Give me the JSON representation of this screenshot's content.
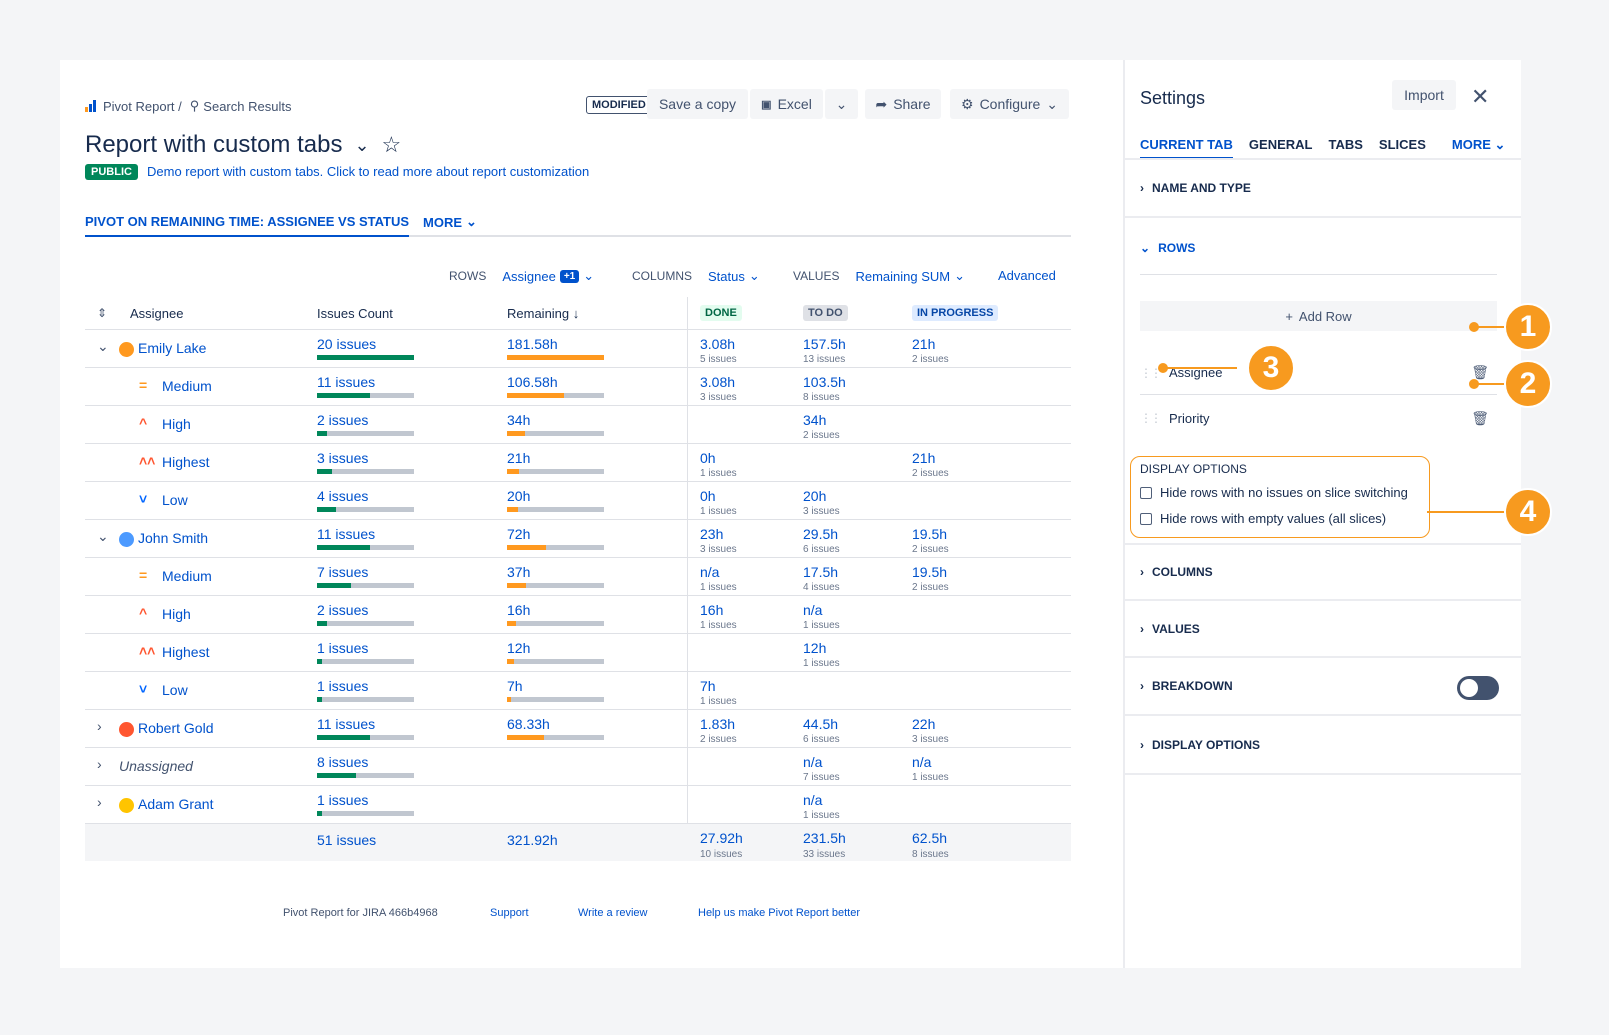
{
  "breadcrumb": {
    "app": "Pivot Report /",
    "search": "Search Results"
  },
  "toolbar": {
    "modified": "MODIFIED",
    "save_copy": "Save a copy",
    "excel": "Excel",
    "share": "Share",
    "configure": "Configure"
  },
  "report": {
    "title": "Report with custom tabs",
    "visibility": "PUBLIC",
    "description": "Demo report with custom tabs. Click to read more about report customization"
  },
  "tabs": {
    "active": "PIVOT ON REMAINING TIME: ASSIGNEE VS STATUS",
    "more": "MORE"
  },
  "config": {
    "rows_label": "ROWS",
    "rows_value": "Assignee",
    "rows_extra": "+1",
    "columns_label": "COLUMNS",
    "columns_value": "Status",
    "values_label": "VALUES",
    "values_value": "Remaining SUM",
    "advanced": "Advanced"
  },
  "table": {
    "headers": {
      "assignee": "Assignee",
      "count": "Issues Count",
      "remaining": "Remaining",
      "done": "DONE",
      "todo": "TO DO",
      "inprogress": "IN PROGRESS"
    },
    "rows": [
      {
        "name": "Emily Lake",
        "level": 0,
        "expanded": true,
        "avatar": "#ff991f",
        "count": "20 issues",
        "count_frac": 1.0,
        "rem": "181.58h",
        "rem_frac": 1.0,
        "done": "3.08h",
        "done_sub": "5 issues",
        "todo": "157.5h",
        "todo_sub": "13 issues",
        "prog": "21h",
        "prog_sub": "2 issues"
      },
      {
        "name": "Medium",
        "level": 1,
        "priority": "medium",
        "count": "11 issues",
        "count_frac": 0.55,
        "rem": "106.58h",
        "rem_frac": 0.59,
        "done": "3.08h",
        "done_sub": "3 issues",
        "todo": "103.5h",
        "todo_sub": "8 issues",
        "prog": "",
        "prog_sub": ""
      },
      {
        "name": "High",
        "level": 1,
        "priority": "high",
        "count": "2 issues",
        "count_frac": 0.1,
        "rem": "34h",
        "rem_frac": 0.19,
        "done": "",
        "done_sub": "",
        "todo": "34h",
        "todo_sub": "2 issues",
        "prog": "",
        "prog_sub": ""
      },
      {
        "name": "Highest",
        "level": 1,
        "priority": "highest",
        "count": "3 issues",
        "count_frac": 0.15,
        "rem": "21h",
        "rem_frac": 0.12,
        "done": "0h",
        "done_sub": "1 issues",
        "todo": "",
        "todo_sub": "",
        "prog": "21h",
        "prog_sub": "2 issues"
      },
      {
        "name": "Low",
        "level": 1,
        "priority": "low",
        "count": "4 issues",
        "count_frac": 0.2,
        "rem": "20h",
        "rem_frac": 0.11,
        "done": "0h",
        "done_sub": "1 issues",
        "todo": "20h",
        "todo_sub": "3 issues",
        "prog": "",
        "prog_sub": ""
      },
      {
        "name": "John Smith",
        "level": 0,
        "expanded": true,
        "avatar": "#4c9aff",
        "count": "11 issues",
        "count_frac": 0.55,
        "rem": "72h",
        "rem_frac": 0.4,
        "done": "23h",
        "done_sub": "3 issues",
        "todo": "29.5h",
        "todo_sub": "6 issues",
        "prog": "19.5h",
        "prog_sub": "2 issues"
      },
      {
        "name": "Medium",
        "level": 1,
        "priority": "medium",
        "count": "7 issues",
        "count_frac": 0.35,
        "rem": "37h",
        "rem_frac": 0.2,
        "done": "n/a",
        "done_sub": "1 issues",
        "todo": "17.5h",
        "todo_sub": "4 issues",
        "prog": "19.5h",
        "prog_sub": "2 issues"
      },
      {
        "name": "High",
        "level": 1,
        "priority": "high",
        "count": "2 issues",
        "count_frac": 0.1,
        "rem": "16h",
        "rem_frac": 0.09,
        "done": "16h",
        "done_sub": "1 issues",
        "todo": "n/a",
        "todo_sub": "1 issues",
        "prog": "",
        "prog_sub": ""
      },
      {
        "name": "Highest",
        "level": 1,
        "priority": "highest",
        "count": "1 issues",
        "count_frac": 0.05,
        "rem": "12h",
        "rem_frac": 0.07,
        "done": "",
        "done_sub": "",
        "todo": "12h",
        "todo_sub": "1 issues",
        "prog": "",
        "prog_sub": ""
      },
      {
        "name": "Low",
        "level": 1,
        "priority": "low",
        "count": "1 issues",
        "count_frac": 0.05,
        "rem": "7h",
        "rem_frac": 0.04,
        "done": "7h",
        "done_sub": "1 issues",
        "todo": "",
        "todo_sub": "",
        "prog": "",
        "prog_sub": ""
      },
      {
        "name": "Robert Gold",
        "level": 0,
        "expanded": false,
        "avatar": "#ff5630",
        "count": "11 issues",
        "count_frac": 0.55,
        "rem": "68.33h",
        "rem_frac": 0.38,
        "done": "1.83h",
        "done_sub": "2 issues",
        "todo": "44.5h",
        "todo_sub": "6 issues",
        "prog": "22h",
        "prog_sub": "3 issues"
      },
      {
        "name": "Unassigned",
        "level": 0,
        "expanded": false,
        "italic": true,
        "count": "8 issues",
        "count_frac": 0.4,
        "rem": "",
        "rem_frac": 0,
        "done": "",
        "done_sub": "",
        "todo": "n/a",
        "todo_sub": "7 issues",
        "prog": "n/a",
        "prog_sub": "1 issues"
      },
      {
        "name": "Adam Grant",
        "level": 0,
        "expanded": false,
        "avatar": "#ffc400",
        "count": "1 issues",
        "count_frac": 0.05,
        "rem": "",
        "rem_frac": 0,
        "done": "",
        "done_sub": "",
        "todo": "n/a",
        "todo_sub": "1 issues",
        "prog": "",
        "prog_sub": ""
      }
    ],
    "total": {
      "count": "51 issues",
      "rem": "321.92h",
      "done": "27.92h",
      "done_sub": "10 issues",
      "todo": "231.5h",
      "todo_sub": "33 issues",
      "prog": "62.5h",
      "prog_sub": "8 issues"
    }
  },
  "footer": {
    "version": "Pivot Report for JIRA 466b4968",
    "support": "Support",
    "review": "Write a review",
    "help": "Help us make Pivot Report better"
  },
  "settings": {
    "title": "Settings",
    "import": "Import",
    "tabs": [
      "CURRENT TAB",
      "GENERAL",
      "TABS",
      "SLICES"
    ],
    "more": "MORE",
    "sections": {
      "name_type": "NAME AND TYPE",
      "rows": "ROWS",
      "columns": "COLUMNS",
      "values": "VALUES",
      "breakdown": "BREAKDOWN",
      "display_options": "DISPLAY OPTIONS"
    },
    "add_row": "Add Row",
    "row_items": [
      "Assignee",
      "Priority"
    ],
    "display_options_label": "DISPLAY OPTIONS",
    "options": [
      "Hide rows with no issues on slice switching",
      "Hide rows with empty values (all slices)"
    ]
  },
  "callouts": [
    "1",
    "2",
    "3",
    "4"
  ],
  "colors": {
    "accent": "#0052cc",
    "green": "#00875a",
    "orange": "#ff991f",
    "callout": "#f79a1f"
  }
}
